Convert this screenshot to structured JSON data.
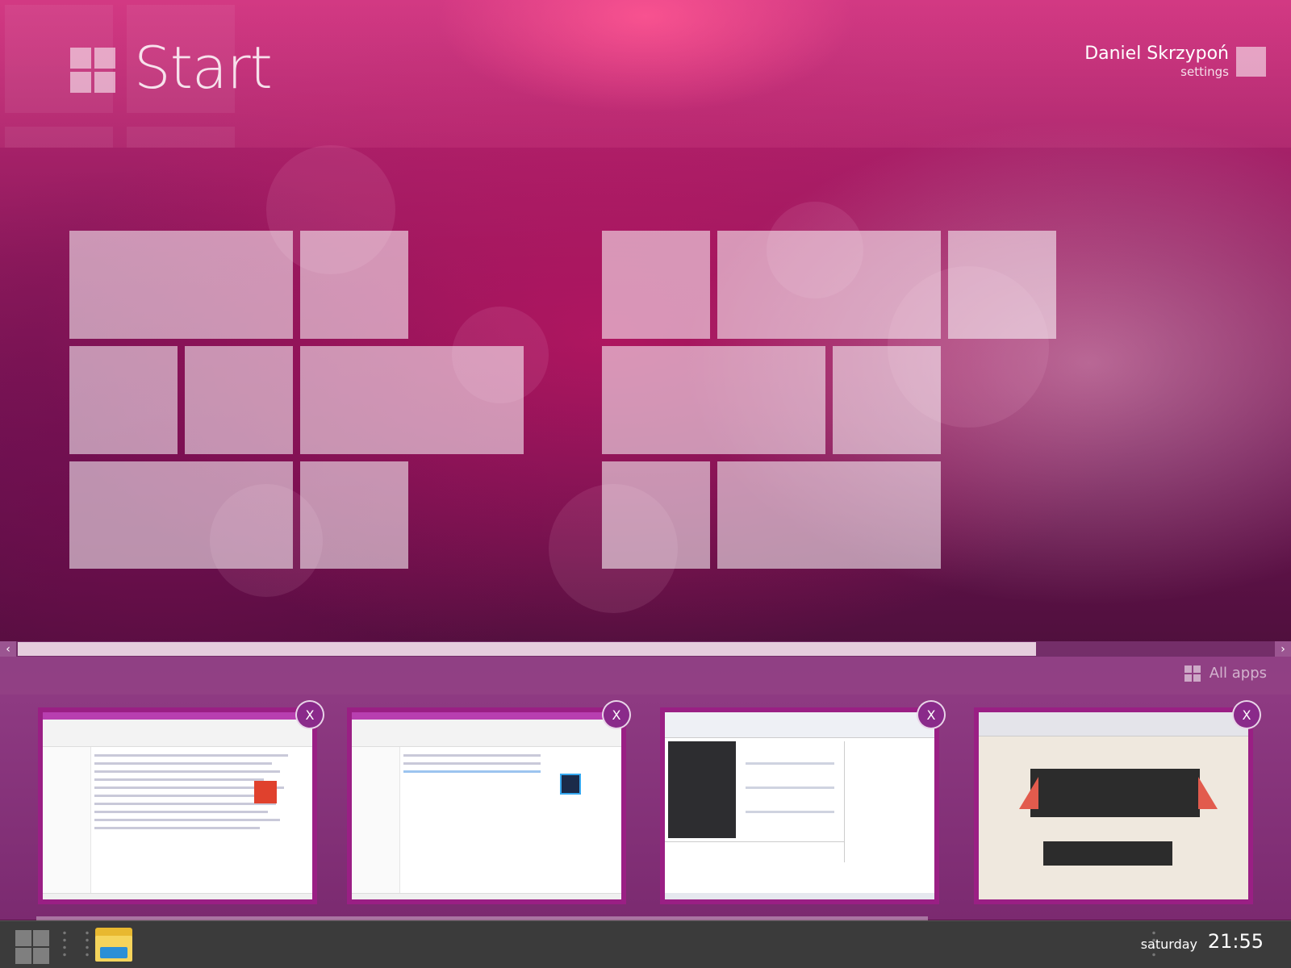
{
  "header": {
    "title": "Start",
    "user_name": "Daniel Skrzypoń",
    "settings_label": "settings"
  },
  "scrollbar": {
    "left_arrow": "‹",
    "right_arrow": "›",
    "position": 0.0,
    "visible_fraction": 0.8
  },
  "all_apps": {
    "label": "All apps",
    "icon": "grid-icon"
  },
  "open_windows": [
    {
      "name": "thumb-music-explorer",
      "close_label": "X"
    },
    {
      "name": "thumb-documents-explorer",
      "close_label": "X"
    },
    {
      "name": "thumb-visual-studio",
      "close_label": "X"
    },
    {
      "name": "thumb-browser-portfolio",
      "close_label": "X"
    }
  ],
  "taskbar": {
    "day": "saturday",
    "time": "21:55",
    "pinned": [
      {
        "name": "file-explorer",
        "icon": "folder-icon"
      }
    ]
  },
  "colors": {
    "accent": "#c62a78",
    "tile": "rgba(255,255,255,0.55)",
    "taskbar": "#3b3b3b",
    "thumb_frame": "#9a1f84"
  }
}
